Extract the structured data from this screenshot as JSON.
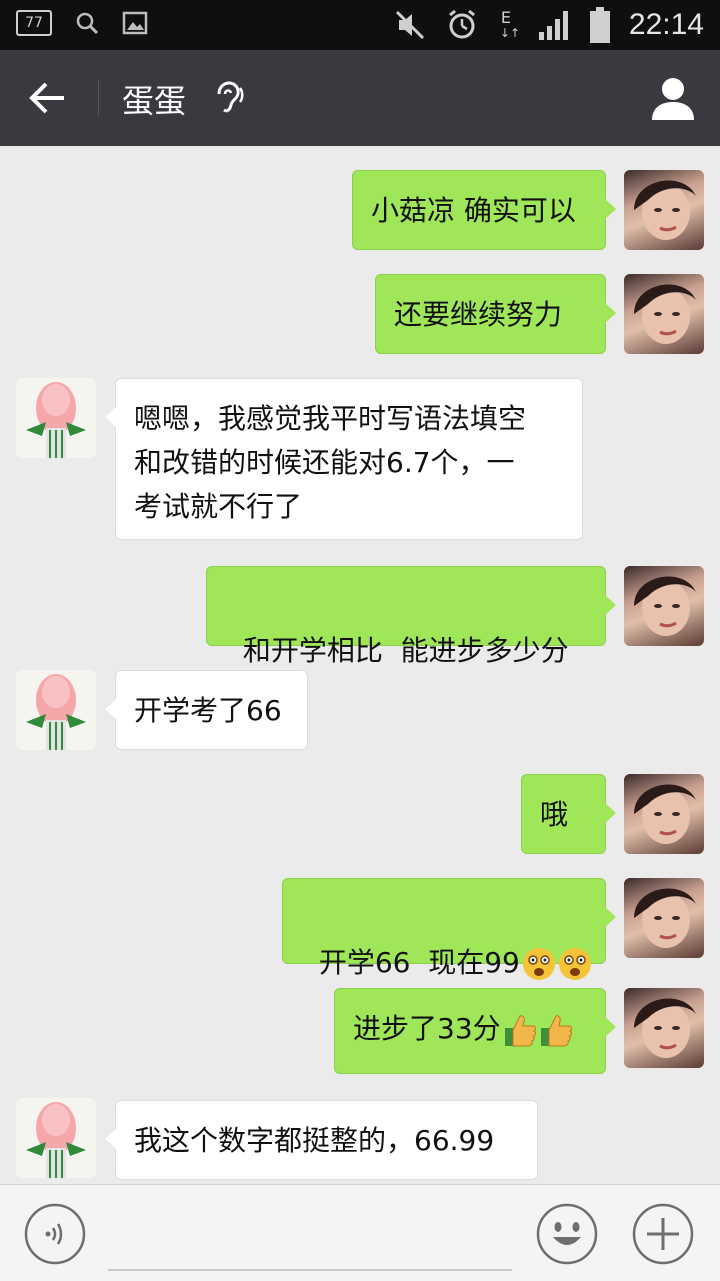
{
  "status_bar": {
    "badge": "77",
    "network": "E",
    "time": "22:14",
    "icons": [
      "sim-badge-icon",
      "search-icon",
      "image-icon",
      "mute-icon",
      "alarm-icon",
      "signal-icon",
      "battery-icon"
    ]
  },
  "header": {
    "title": "蛋蛋",
    "icons": [
      "back-arrow-icon",
      "earpiece-icon",
      "profile-icon"
    ]
  },
  "messages": [
    {
      "from": "me",
      "text": "小菇凉 确实可以"
    },
    {
      "from": "me",
      "text": "还要继续努力"
    },
    {
      "from": "other",
      "lines": [
        "嗯嗯，我感觉我平时写语法填空",
        "和改错的时候还能对6.7个，一",
        "考试就不行了"
      ]
    },
    {
      "from": "me",
      "text": "和开学相比  能进步多少分"
    },
    {
      "from": "other",
      "text": "开学考了66"
    },
    {
      "from": "me",
      "text": "哦"
    },
    {
      "from": "me",
      "text": "开学66  现在99",
      "emoji": [
        "surprised-face-icon",
        "surprised-face-icon"
      ]
    },
    {
      "from": "me",
      "text": "进步了33分",
      "emoji": [
        "thumbs-up-icon",
        "thumbs-up-icon"
      ]
    },
    {
      "from": "other",
      "text": "我这个数字都挺整的，66.99"
    }
  ],
  "input_bar": {
    "icons": [
      "voice-icon",
      "smiley-icon",
      "plus-icon"
    ]
  },
  "colors": {
    "my_bubble": "#9fe658",
    "other_bubble": "#ffffff",
    "title_bar": "#393a3f",
    "background": "#ebebeb"
  }
}
